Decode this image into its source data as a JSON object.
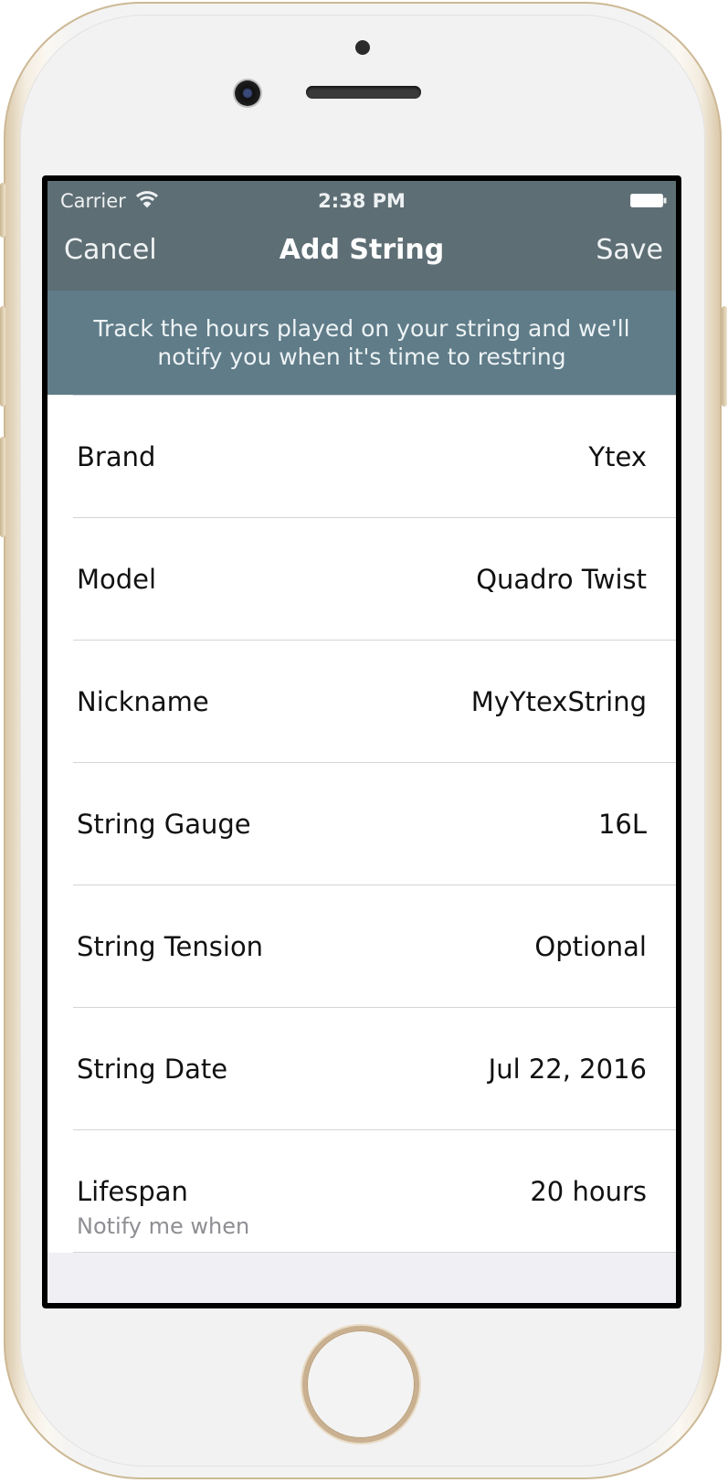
{
  "status_bar": {
    "carrier": "Carrier",
    "time": "2:38 PM"
  },
  "nav": {
    "cancel_label": "Cancel",
    "title": "Add String",
    "save_label": "Save"
  },
  "banner": {
    "text": "Track the hours played on your string and we'll notify you when it's time to restring"
  },
  "fields": [
    {
      "label": "Brand",
      "value": "Ytex"
    },
    {
      "label": "Model",
      "value": "Quadro Twist"
    },
    {
      "label": "Nickname",
      "value": "MyYtexString"
    },
    {
      "label": "String Gauge",
      "value": "16L"
    },
    {
      "label": "String Tension",
      "value": "Optional"
    },
    {
      "label": "String Date",
      "value": "Jul 22, 2016"
    },
    {
      "label": "Lifespan",
      "value": "20 hours",
      "subtitle": "Notify me when"
    }
  ],
  "colors": {
    "nav_background": "#5e6e75",
    "banner_background": "#5f7c88"
  }
}
